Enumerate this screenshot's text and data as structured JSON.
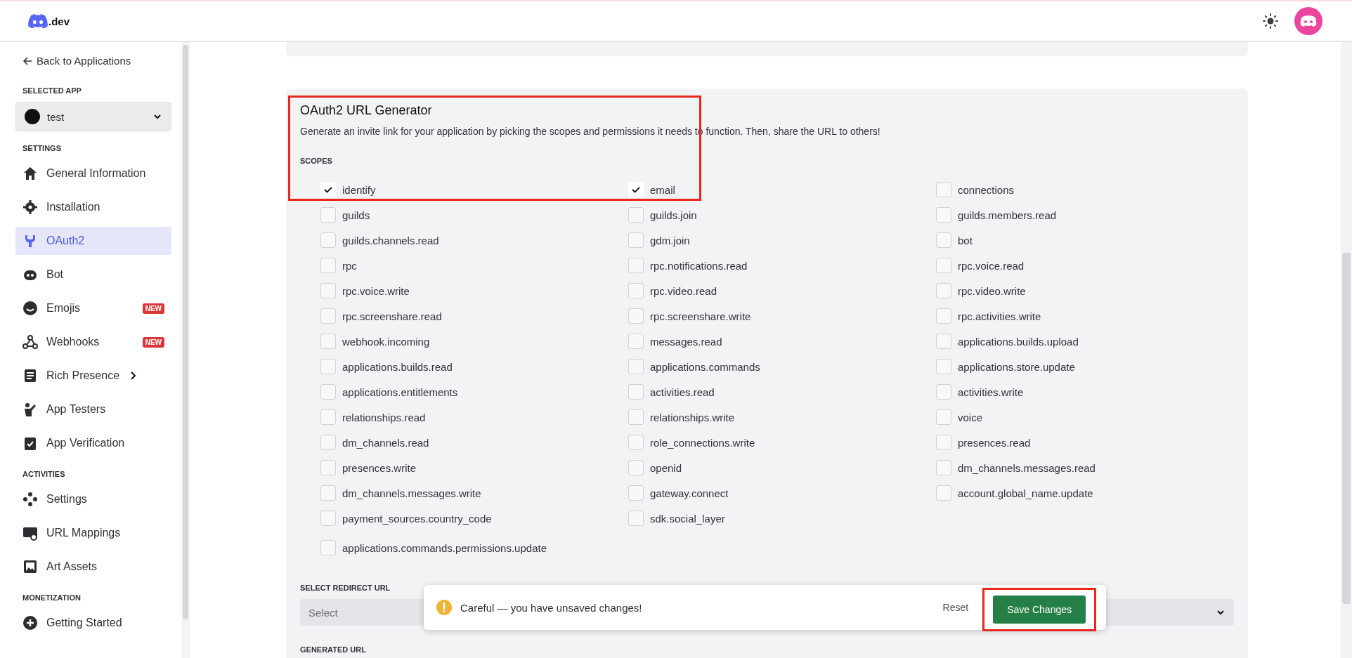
{
  "header": {
    "logo_text": ".dev"
  },
  "sidebar": {
    "back_link": "Back to Applications",
    "selected_app_label": "SELECTED APP",
    "selected_app": "test",
    "sections": [
      {
        "title": "SETTINGS",
        "items": [
          {
            "label": "General Information",
            "selected": false
          },
          {
            "label": "Installation",
            "selected": false
          },
          {
            "label": "OAuth2",
            "selected": true
          },
          {
            "label": "Bot",
            "selected": false
          },
          {
            "label": "Emojis",
            "selected": false,
            "badge": "NEW"
          },
          {
            "label": "Webhooks",
            "selected": false,
            "badge": "NEW"
          },
          {
            "label": "Rich Presence",
            "selected": false,
            "has_submenu": true
          },
          {
            "label": "App Testers",
            "selected": false
          },
          {
            "label": "App Verification",
            "selected": false
          }
        ]
      },
      {
        "title": "ACTIVITIES",
        "items": [
          {
            "label": "Settings",
            "selected": false
          },
          {
            "label": "URL Mappings",
            "selected": false
          },
          {
            "label": "Art Assets",
            "selected": false
          }
        ]
      },
      {
        "title": "MONETIZATION",
        "items": [
          {
            "label": "Getting Started",
            "selected": false
          }
        ]
      }
    ]
  },
  "oauth": {
    "title": "OAuth2 URL Generator",
    "highlighted": true,
    "description": "Generate an invite link for your application by picking the scopes and permissions it needs to function. Then, share the URL to others!",
    "scopes_label": "SCOPES",
    "scopes": [
      {
        "name": "identify",
        "checked": true
      },
      {
        "name": "email",
        "checked": true
      },
      {
        "name": "connections",
        "checked": false
      },
      {
        "name": "guilds",
        "checked": false
      },
      {
        "name": "guilds.join",
        "checked": false
      },
      {
        "name": "guilds.members.read",
        "checked": false
      },
      {
        "name": "guilds.channels.read",
        "checked": false
      },
      {
        "name": "gdm.join",
        "checked": false
      },
      {
        "name": "bot",
        "checked": false
      },
      {
        "name": "rpc",
        "checked": false
      },
      {
        "name": "rpc.notifications.read",
        "checked": false
      },
      {
        "name": "rpc.voice.read",
        "checked": false
      },
      {
        "name": "rpc.voice.write",
        "checked": false
      },
      {
        "name": "rpc.video.read",
        "checked": false
      },
      {
        "name": "rpc.video.write",
        "checked": false
      },
      {
        "name": "rpc.screenshare.read",
        "checked": false
      },
      {
        "name": "rpc.screenshare.write",
        "checked": false
      },
      {
        "name": "rpc.activities.write",
        "checked": false
      },
      {
        "name": "webhook.incoming",
        "checked": false
      },
      {
        "name": "messages.read",
        "checked": false
      },
      {
        "name": "applications.builds.upload",
        "checked": false
      },
      {
        "name": "applications.builds.read",
        "checked": false
      },
      {
        "name": "applications.commands",
        "checked": false
      },
      {
        "name": "applications.store.update",
        "checked": false
      },
      {
        "name": "applications.entitlements",
        "checked": false
      },
      {
        "name": "activities.read",
        "checked": false
      },
      {
        "name": "activities.write",
        "checked": false
      },
      {
        "name": "relationships.read",
        "checked": false
      },
      {
        "name": "relationships.write",
        "checked": false
      },
      {
        "name": "voice",
        "checked": false
      },
      {
        "name": "dm_channels.read",
        "checked": false
      },
      {
        "name": "role_connections.write",
        "checked": false
      },
      {
        "name": "presences.read",
        "checked": false
      },
      {
        "name": "presences.write",
        "checked": false
      },
      {
        "name": "openid",
        "checked": false
      },
      {
        "name": "dm_channels.messages.read",
        "checked": false
      },
      {
        "name": "dm_channels.messages.write",
        "checked": false
      },
      {
        "name": "gateway.connect",
        "checked": false
      },
      {
        "name": "account.global_name.update",
        "checked": false
      },
      {
        "name": "payment_sources.country_code",
        "checked": false
      },
      {
        "name": "sdk.social_layer",
        "checked": false
      }
    ],
    "more_scopes": [
      {
        "name": "applications.commands.permissions.update",
        "checked": false
      }
    ],
    "redirect_label": "SELECT REDIRECT URL",
    "redirect_placeholder": "Select",
    "generated_label": "GENERATED URL"
  },
  "toast": {
    "message": "Careful — you have unsaved changes!",
    "reset": "Reset",
    "save": "Save Changes",
    "save_highlighted": true
  }
}
